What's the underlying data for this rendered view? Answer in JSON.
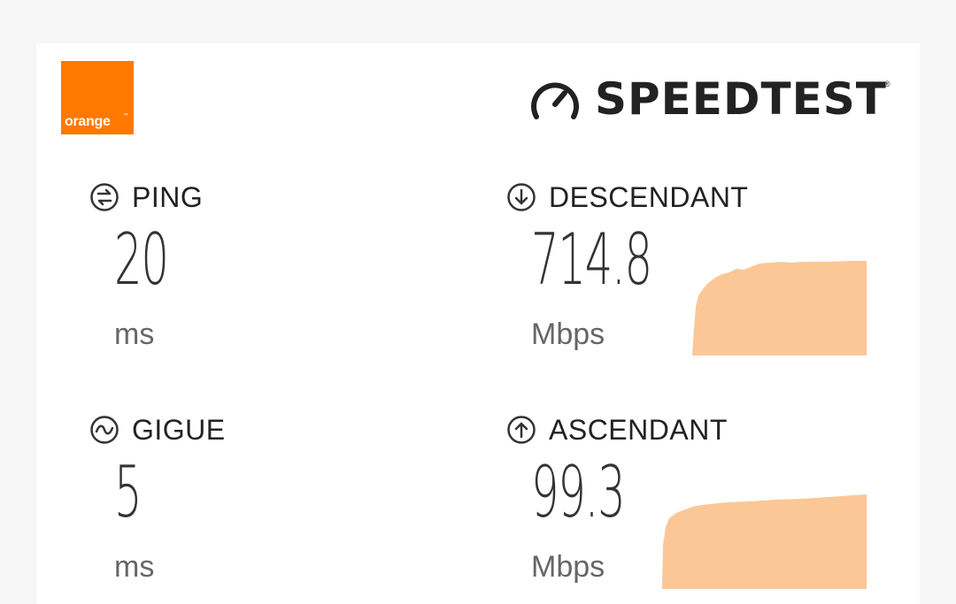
{
  "logo": {
    "text": "orange",
    "color": "#ff7900"
  },
  "brand": {
    "name": "SPEEDTEST",
    "icon": "speedometer-icon"
  },
  "metrics": {
    "ping": {
      "label": "PING",
      "value": "20",
      "unit": "ms",
      "icon": "ping-icon"
    },
    "jitter": {
      "label": "GIGUE",
      "value": "5",
      "unit": "ms",
      "icon": "jitter-icon"
    },
    "download": {
      "label": "DESCENDANT",
      "value": "714.8",
      "unit": "Mbps",
      "icon": "download-arrow-icon"
    },
    "upload": {
      "label": "ASCENDANT",
      "value": "99.3",
      "unit": "Mbps",
      "icon": "upload-arrow-icon"
    }
  },
  "colors": {
    "graph_fill": "#fcc796",
    "text": "#222222",
    "unit_text": "#666666"
  }
}
